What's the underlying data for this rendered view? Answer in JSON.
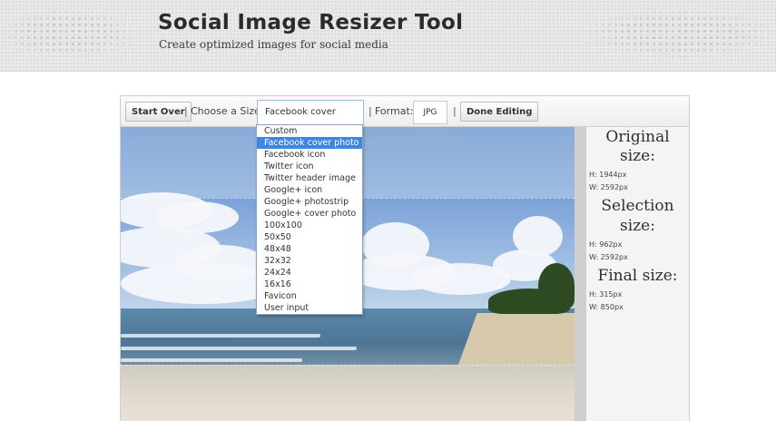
{
  "header": {
    "title": "Social Image Resizer Tool",
    "subtitle": "Create optimized images for social media"
  },
  "toolbar": {
    "start_over_label": "Start Over",
    "separator": "|",
    "choose_size_label": "Choose a Size:",
    "size_selected": "Facebook cover photo",
    "format_label": "Format:",
    "format_value": "JPG",
    "done_label": "Done Editing"
  },
  "size_options": [
    "Custom",
    "Facebook cover photo",
    "Facebook icon",
    "Twitter icon",
    "Twitter header image",
    "Google+ icon",
    "Google+ photostrip",
    "Google+ cover photo",
    "100x100",
    "50x50",
    "48x48",
    "32x32",
    "24x24",
    "16x16",
    "Favicon",
    "User input"
  ],
  "selected_option_index": 1,
  "info_panel": {
    "original_heading_1": "Original",
    "original_heading_2": "size:",
    "original_h": "H: 1944px",
    "original_w": "W: 2592px",
    "selection_heading_1": "Selection",
    "selection_heading_2": "size:",
    "selection_h": "H: 962px",
    "selection_w": "W: 2592px",
    "final_heading": "Final size:",
    "final_h": "H: 315px",
    "final_w": "W: 850px"
  },
  "icons": {
    "dropdown_list": "select-list"
  }
}
